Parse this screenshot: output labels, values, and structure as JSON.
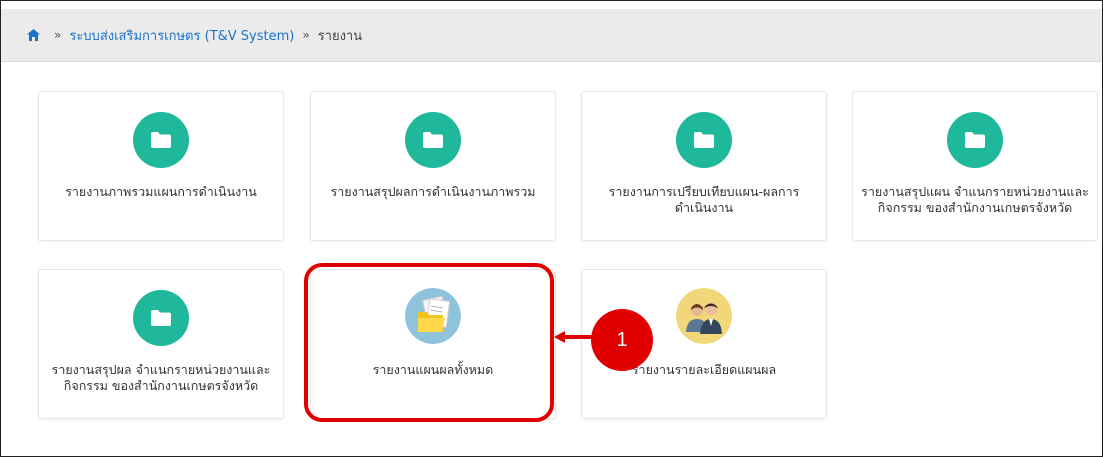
{
  "breadcrumb": {
    "home_icon": "home-icon",
    "separator": "»",
    "system_link": "ระบบส่งเสริมการเกษตร (T&V System)",
    "current": "รายงาน"
  },
  "cards": [
    {
      "label": "รายงานภาพรวมแผนการดำเนินงาน",
      "icon": "folder-icon"
    },
    {
      "label": "รายงานสรุปผลการดำเนินงานภาพรวม",
      "icon": "folder-icon"
    },
    {
      "label": "รายงานการเปรียบเทียบแผน-ผลการดำเนินงาน",
      "icon": "folder-icon"
    },
    {
      "label": "รายงานสรุปแผน จำแนกรายหน่วยงานและกิจกรรม ของสำนักงานเกษตรจังหวัด",
      "icon": "folder-icon"
    },
    {
      "label": "รายงานสรุปผล จำแนกรายหน่วยงานและกิจกรรม ของสำนักงานเกษตรจังหวัด",
      "icon": "folder-icon"
    },
    {
      "label": "รายงานแผนผลทั้งหมด",
      "icon": "documents-folder-icon"
    },
    {
      "label": "รายงานรายละเอียดแผนผล",
      "icon": "people-icon"
    }
  ],
  "annotation": {
    "callout_number": "1",
    "highlight_color": "#e00000"
  },
  "colors": {
    "accent": "#1fb89a",
    "link": "#1a73c9"
  }
}
